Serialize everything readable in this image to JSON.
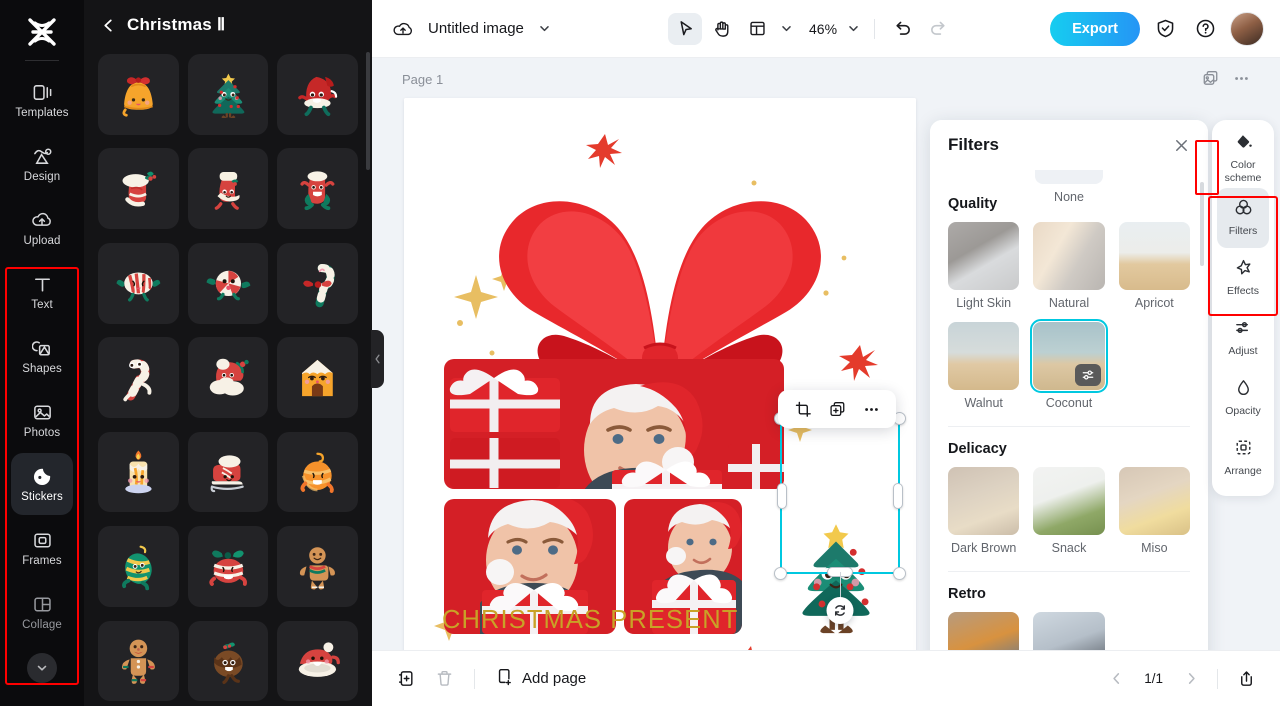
{
  "left_rail": {
    "logo": "capcut-logo",
    "items": [
      {
        "label": "Templates",
        "icon": "templates-icon",
        "active": false
      },
      {
        "label": "Design",
        "icon": "design-icon",
        "active": false
      },
      {
        "label": "Upload",
        "icon": "upload-icon",
        "active": false
      },
      {
        "label": "Text",
        "icon": "text-icon",
        "active": false
      },
      {
        "label": "Shapes",
        "icon": "shapes-icon",
        "active": false
      },
      {
        "label": "Photos",
        "icon": "photos-icon",
        "active": false
      },
      {
        "label": "Stickers",
        "icon": "stickers-icon",
        "active": true
      },
      {
        "label": "Frames",
        "icon": "frames-icon",
        "active": false
      },
      {
        "label": "Collage",
        "icon": "collage-icon",
        "active": false
      }
    ],
    "expand_icon": "chevron-down-icon"
  },
  "sticker_panel": {
    "back_icon": "chevron-left-icon",
    "title": "Christmas Ⅱ",
    "stickers": [
      "bell-with-bow",
      "christmas-tree",
      "santa-hat-character",
      "stocking-holly",
      "stocking-cream",
      "stocking-skull",
      "candy-striped",
      "candy-peppermint",
      "candy-cane-bow",
      "candy-cane-running",
      "santa-hat-cloud",
      "gingerbread-house",
      "candle",
      "ice-skate",
      "orange-ornament",
      "green-ornament",
      "red-bow-ornament",
      "gingerbread-man",
      "gingerbread-boy",
      "chocolate-pudding",
      "santa-hat-plate"
    ]
  },
  "topbar": {
    "cloud_icon": "cloud-save-icon",
    "doc_name": "Untitled image",
    "name_caret_icon": "chevron-down-icon",
    "tools": [
      {
        "name": "select-tool",
        "icon": "cursor-arrow-icon",
        "selected": true
      },
      {
        "name": "hand-tool",
        "icon": "hand-icon",
        "selected": false
      },
      {
        "name": "layout-tool",
        "icon": "layout-panel-icon",
        "selected": false
      }
    ],
    "layout_caret_icon": "chevron-down-icon",
    "zoom_level": "46%",
    "zoom_caret_icon": "chevron-down-icon",
    "undo_icon": "undo-icon",
    "redo_icon": "redo-icon",
    "export_label": "Export",
    "shield_icon": "shield-check-icon",
    "help_icon": "question-circle-icon",
    "avatar": "user-avatar"
  },
  "canvas": {
    "page_label": "Page 1",
    "duplicate_page_icon": "duplicate-page-icon",
    "more_icon": "more-horizontal-icon",
    "artwork_text": "CHRISTMAS PRESENT",
    "artwork_text_color": "#c9a227",
    "object_toolbar": [
      {
        "name": "crop-button",
        "icon": "crop-icon"
      },
      {
        "name": "duplicate-button",
        "icon": "duplicate-icon"
      },
      {
        "name": "more-options-button",
        "icon": "more-horizontal-icon"
      }
    ],
    "rotate_icon": "rotate-icon"
  },
  "filters_panel": {
    "title": "Filters",
    "close_icon": "close-icon",
    "none_label": "None",
    "groups": [
      {
        "title": "Quality",
        "items": [
          {
            "label": "Light Skin",
            "thumb": "th-lightskin",
            "selected": false
          },
          {
            "label": "Natural",
            "thumb": "th-natural",
            "selected": false
          },
          {
            "label": "Apricot",
            "thumb": "th-apricot",
            "selected": false
          },
          {
            "label": "Walnut",
            "thumb": "th-walnut",
            "selected": false
          },
          {
            "label": "Coconut",
            "thumb": "th-coconut",
            "selected": true
          }
        ]
      },
      {
        "title": "Delicacy",
        "items": [
          {
            "label": "Dark Brown",
            "thumb": "th-darkbrown",
            "selected": false
          },
          {
            "label": "Snack",
            "thumb": "th-snack",
            "selected": false
          },
          {
            "label": "Miso",
            "thumb": "th-miso",
            "selected": false
          }
        ]
      },
      {
        "title": "Retro",
        "items": [
          {
            "label": "",
            "thumb": "th-retro1",
            "selected": false
          },
          {
            "label": "",
            "thumb": "th-retro2",
            "selected": false
          }
        ]
      }
    ],
    "adjust_badge_icon": "sliders-icon",
    "selection_color": "#00c8e0"
  },
  "right_rail": {
    "items": [
      {
        "label": "Color scheme",
        "icon": "paint-bucket-icon",
        "active": false
      },
      {
        "label": "Filters",
        "icon": "filters-circles-icon",
        "active": true
      },
      {
        "label": "Effects",
        "icon": "effects-star-icon",
        "active": false
      },
      {
        "label": "Adjust",
        "icon": "sliders-icon",
        "active": false
      },
      {
        "label": "Opacity",
        "icon": "droplet-icon",
        "active": false
      },
      {
        "label": "Arrange",
        "icon": "arrange-icon",
        "active": false
      }
    ]
  },
  "bottombar": {
    "duplicate_icon": "duplicate-page-icon",
    "delete_icon": "trash-icon",
    "add_page_icon": "add-page-icon",
    "add_page_label": "Add page",
    "prev_icon": "chevron-left-icon",
    "page_indicator": "1/1",
    "next_icon": "chevron-right-icon",
    "export_panel_icon": "export-up-icon"
  },
  "annotations": {
    "color": "#ff0000",
    "boxes": [
      "left-rail-tools-group",
      "filters-effects-group",
      "filters-panel-scroll"
    ]
  }
}
